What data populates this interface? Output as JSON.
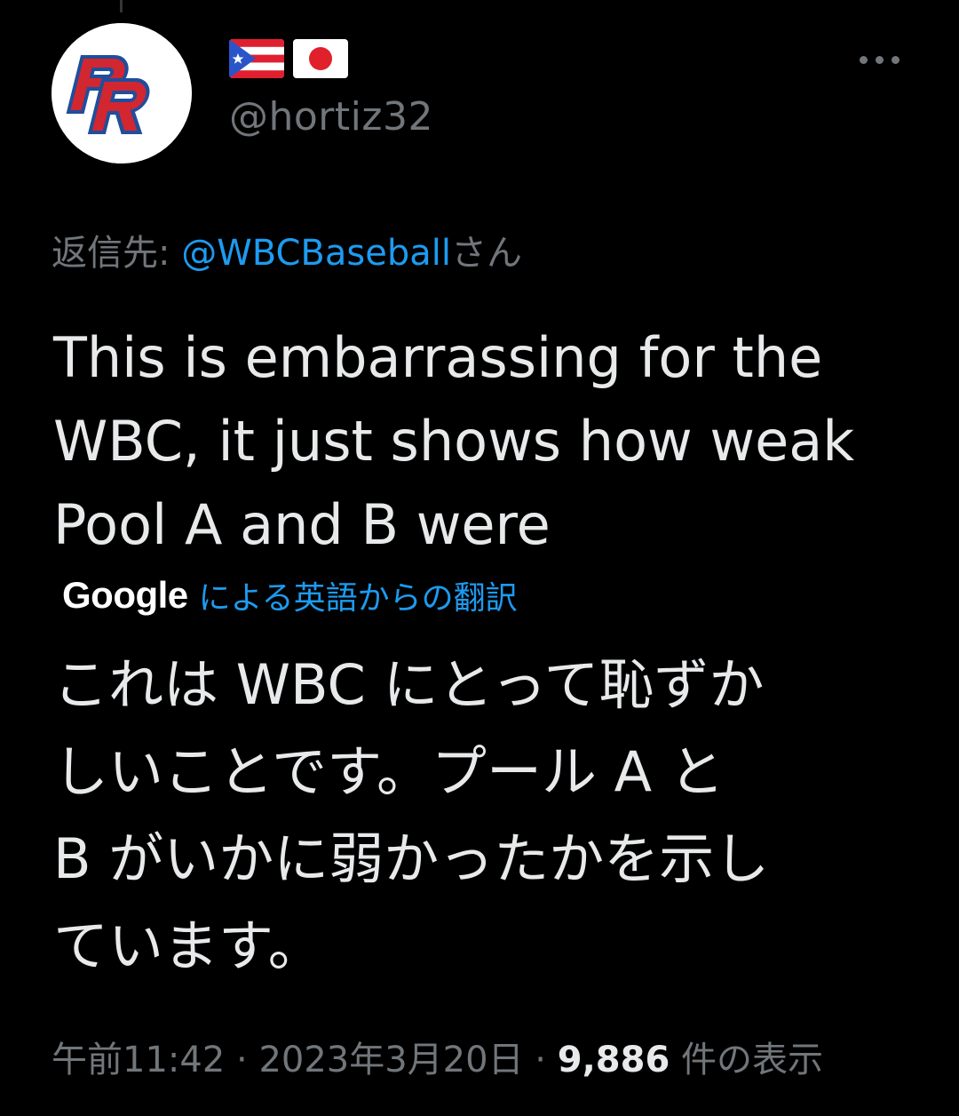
{
  "tweet": {
    "avatar_icon": "pr-logo-icon",
    "flags": [
      "puerto-rico-flag-icon",
      "japan-flag-icon"
    ],
    "handle": "@hortiz32",
    "more_icon": "more-options-icon",
    "reply_prefix": "返信先: ",
    "reply_mention": "@WBCBaseball",
    "reply_suffix": "さん",
    "text": "This is embarrassing for the WBC, it just shows how weak Pool A and B were",
    "translation_brand": "Google",
    "translation_label": "による英語からの翻訳",
    "translated_text": "これは WBC にとって恥ずか\nしいことです。プール A と\nB がいかに弱かったかを示し\nています。",
    "time": "午前11:42",
    "separator": " · ",
    "date": "2023年3月20日",
    "views_count": "9,886",
    "views_label": " 件の表示"
  },
  "colors": {
    "background": "#000000",
    "text": "#e7e9ea",
    "secondary": "#71767b",
    "link": "#1d9bf0",
    "pr_red": "#d22630",
    "pr_blue": "#1f4e9c"
  }
}
